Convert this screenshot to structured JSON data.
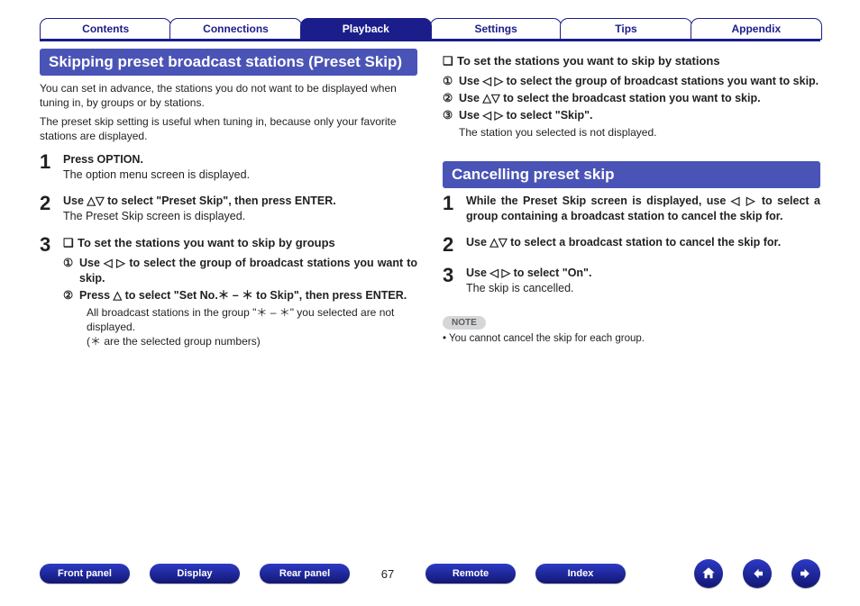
{
  "nav": {
    "tabs": [
      {
        "label": "Contents"
      },
      {
        "label": "Connections"
      },
      {
        "label": "Playback"
      },
      {
        "label": "Settings"
      },
      {
        "label": "Tips"
      },
      {
        "label": "Appendix"
      }
    ],
    "active_index": 2
  },
  "left": {
    "heading": "Skipping preset broadcast stations (Preset Skip)",
    "intro1": "You can set in advance, the stations you do not want to be displayed when tuning in, by groups or by stations.",
    "intro2": "The preset skip setting is useful when tuning in, because only your favorite stations are displayed.",
    "steps": {
      "s1_num": "1",
      "s1_bold": "Press OPTION.",
      "s1_sub": "The option menu screen is displayed.",
      "s2_num": "2",
      "s2_bold": "Use △▽ to select \"Preset Skip\", then press ENTER.",
      "s2_sub": "The Preset Skip screen is displayed.",
      "s3_num": "3",
      "s3_q_icon": "❏",
      "s3_q_title": "To set the stations you want to skip by groups",
      "s3_e1_num": "①",
      "s3_e1_body": "Use ◁ ▷ to select the group of broadcast stations you want to skip.",
      "s3_e2_num": "②",
      "s3_e2_body": "Press △ to select \"Set No.＊ – ＊ to Skip\", then press ENTER.",
      "s3_sub1": "All broadcast stations in the group \"＊ – ＊\" you selected are not displayed.",
      "s3_sub2": "(＊ are the selected group numbers)"
    }
  },
  "right": {
    "top_q_icon": "❏",
    "top_q_title": "To set the stations you want to skip by stations",
    "e1_num": "①",
    "e1_body": "Use ◁ ▷ to select the group of broadcast stations you want to skip.",
    "e2_num": "②",
    "e2_body": "Use △▽ to select the broadcast station you want to skip.",
    "e3_num": "③",
    "e3_body": "Use ◁ ▷ to select \"Skip\".",
    "e3_sub": "The station you selected is not displayed.",
    "heading2": "Cancelling preset skip",
    "c1_num": "1",
    "c1_body": "While the Preset Skip screen is displayed, use ◁ ▷ to select a group containing a broadcast station to cancel the skip for.",
    "c2_num": "2",
    "c2_body": "Use △▽ to select a broadcast station to cancel the skip for.",
    "c3_num": "3",
    "c3_body": "Use ◁ ▷ to select \"On\".",
    "c3_sub": "The skip is cancelled.",
    "note_label": "NOTE",
    "note_text": "• You cannot cancel the skip for each group."
  },
  "footer": {
    "links": [
      "Front panel",
      "Display",
      "Rear panel"
    ],
    "page": "67",
    "links2": [
      "Remote",
      "Index"
    ],
    "icons": [
      "home-icon",
      "prev-icon",
      "next-icon"
    ]
  }
}
